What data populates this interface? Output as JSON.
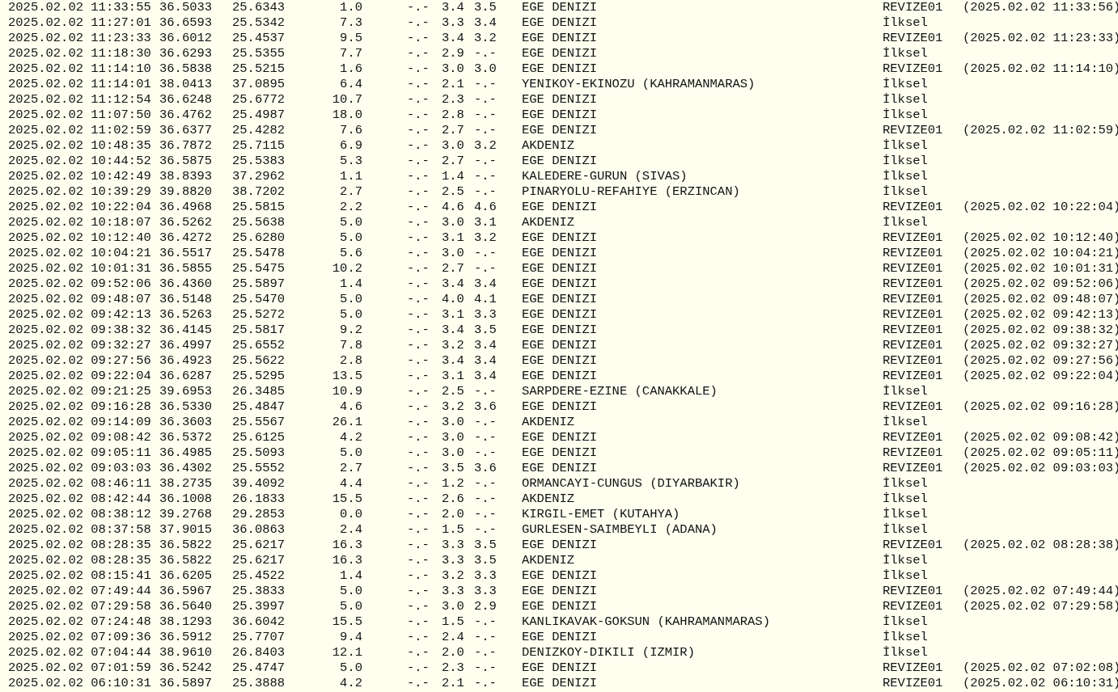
{
  "rows": [
    {
      "date": "2025.02.02 11:33:55",
      "lat": "36.5033",
      "lon": "25.6343",
      "depth": "1.0",
      "md": "-.-",
      "ml": "3.4",
      "mw": "3.5",
      "location": "EGE DENIZI",
      "quality": "REVIZE01",
      "revision": "(2025.02.02 11:33:56)"
    },
    {
      "date": "2025.02.02 11:27:01",
      "lat": "36.6593",
      "lon": "25.5342",
      "depth": "7.3",
      "md": "-.-",
      "ml": "3.3",
      "mw": "3.4",
      "location": "EGE DENIZI",
      "quality": "İlksel"
    },
    {
      "date": "2025.02.02 11:23:33",
      "lat": "36.6012",
      "lon": "25.4537",
      "depth": "9.5",
      "md": "-.-",
      "ml": "3.4",
      "mw": "3.2",
      "location": "EGE DENIZI",
      "quality": "REVIZE01",
      "revision": "(2025.02.02 11:23:33)"
    },
    {
      "date": "2025.02.02 11:18:30",
      "lat": "36.6293",
      "lon": "25.5355",
      "depth": "7.7",
      "md": "-.-",
      "ml": "2.9",
      "mw": "-.-",
      "location": "EGE DENIZI",
      "quality": "İlksel"
    },
    {
      "date": "2025.02.02 11:14:10",
      "lat": "36.5838",
      "lon": "25.5215",
      "depth": "1.6",
      "md": "-.-",
      "ml": "3.0",
      "mw": "3.0",
      "location": "EGE DENIZI",
      "quality": "REVIZE01",
      "revision": "(2025.02.02 11:14:10)"
    },
    {
      "date": "2025.02.02 11:14:01",
      "lat": "38.0413",
      "lon": "37.0895",
      "depth": "6.4",
      "md": "-.-",
      "ml": "2.1",
      "mw": "-.-",
      "location": "YENIKOY-EKINOZU (KAHRAMANMARAS)",
      "quality": "İlksel"
    },
    {
      "date": "2025.02.02 11:12:54",
      "lat": "36.6248",
      "lon": "25.6772",
      "depth": "10.7",
      "md": "-.-",
      "ml": "2.3",
      "mw": "-.-",
      "location": "EGE DENIZI",
      "quality": "İlksel"
    },
    {
      "date": "2025.02.02 11:07:50",
      "lat": "36.4762",
      "lon": "25.4987",
      "depth": "18.0",
      "md": "-.-",
      "ml": "2.8",
      "mw": "-.-",
      "location": "EGE DENIZI",
      "quality": "İlksel"
    },
    {
      "date": "2025.02.02 11:02:59",
      "lat": "36.6377",
      "lon": "25.4282",
      "depth": "7.6",
      "md": "-.-",
      "ml": "2.7",
      "mw": "-.-",
      "location": "EGE DENIZI",
      "quality": "REVIZE01",
      "revision": "(2025.02.02 11:02:59)"
    },
    {
      "date": "2025.02.02 10:48:35",
      "lat": "36.7872",
      "lon": "25.7115",
      "depth": "6.9",
      "md": "-.-",
      "ml": "3.0",
      "mw": "3.2",
      "location": "AKDENIZ",
      "quality": "İlksel"
    },
    {
      "date": "2025.02.02 10:44:52",
      "lat": "36.5875",
      "lon": "25.5383",
      "depth": "5.3",
      "md": "-.-",
      "ml": "2.7",
      "mw": "-.-",
      "location": "EGE DENIZI",
      "quality": "İlksel"
    },
    {
      "date": "2025.02.02 10:42:49",
      "lat": "38.8393",
      "lon": "37.2962",
      "depth": "1.1",
      "md": "-.-",
      "ml": "1.4",
      "mw": "-.-",
      "location": "KALEDERE-GURUN (SIVAS)",
      "quality": "İlksel"
    },
    {
      "date": "2025.02.02 10:39:29",
      "lat": "39.8820",
      "lon": "38.7202",
      "depth": "2.7",
      "md": "-.-",
      "ml": "2.5",
      "mw": "-.-",
      "location": "PINARYOLU-REFAHIYE (ERZINCAN)",
      "quality": "İlksel"
    },
    {
      "date": "2025.02.02 10:22:04",
      "lat": "36.4968",
      "lon": "25.5815",
      "depth": "2.2",
      "md": "-.-",
      "ml": "4.6",
      "mw": "4.6",
      "location": "EGE DENIZI",
      "quality": "REVIZE01",
      "revision": "(2025.02.02 10:22:04)"
    },
    {
      "date": "2025.02.02 10:18:07",
      "lat": "36.5262",
      "lon": "25.5638",
      "depth": "5.0",
      "md": "-.-",
      "ml": "3.0",
      "mw": "3.1",
      "location": "AKDENIZ",
      "quality": "İlksel"
    },
    {
      "date": "2025.02.02 10:12:40",
      "lat": "36.4272",
      "lon": "25.6280",
      "depth": "5.0",
      "md": "-.-",
      "ml": "3.1",
      "mw": "3.2",
      "location": "EGE DENIZI",
      "quality": "REVIZE01",
      "revision": "(2025.02.02 10:12:40)"
    },
    {
      "date": "2025.02.02 10:04:21",
      "lat": "36.5517",
      "lon": "25.5478",
      "depth": "5.6",
      "md": "-.-",
      "ml": "3.0",
      "mw": "-.-",
      "location": "EGE DENIZI",
      "quality": "REVIZE01",
      "revision": "(2025.02.02 10:04:21)"
    },
    {
      "date": "2025.02.02 10:01:31",
      "lat": "36.5855",
      "lon": "25.5475",
      "depth": "10.2",
      "md": "-.-",
      "ml": "2.7",
      "mw": "-.-",
      "location": "EGE DENIZI",
      "quality": "REVIZE01",
      "revision": "(2025.02.02 10:01:31)"
    },
    {
      "date": "2025.02.02 09:52:06",
      "lat": "36.4360",
      "lon": "25.5897",
      "depth": "1.4",
      "md": "-.-",
      "ml": "3.4",
      "mw": "3.4",
      "location": "EGE DENIZI",
      "quality": "REVIZE01",
      "revision": "(2025.02.02 09:52:06)"
    },
    {
      "date": "2025.02.02 09:48:07",
      "lat": "36.5148",
      "lon": "25.5470",
      "depth": "5.0",
      "md": "-.-",
      "ml": "4.0",
      "mw": "4.1",
      "location": "EGE DENIZI",
      "quality": "REVIZE01",
      "revision": "(2025.02.02 09:48:07)"
    },
    {
      "date": "2025.02.02 09:42:13",
      "lat": "36.5263",
      "lon": "25.5272",
      "depth": "5.0",
      "md": "-.-",
      "ml": "3.1",
      "mw": "3.3",
      "location": "EGE DENIZI",
      "quality": "REVIZE01",
      "revision": "(2025.02.02 09:42:13)"
    },
    {
      "date": "2025.02.02 09:38:32",
      "lat": "36.4145",
      "lon": "25.5817",
      "depth": "9.2",
      "md": "-.-",
      "ml": "3.4",
      "mw": "3.5",
      "location": "EGE DENIZI",
      "quality": "REVIZE01",
      "revision": "(2025.02.02 09:38:32)"
    },
    {
      "date": "2025.02.02 09:32:27",
      "lat": "36.4997",
      "lon": "25.6552",
      "depth": "7.8",
      "md": "-.-",
      "ml": "3.2",
      "mw": "3.4",
      "location": "EGE DENIZI",
      "quality": "REVIZE01",
      "revision": "(2025.02.02 09:32:27)"
    },
    {
      "date": "2025.02.02 09:27:56",
      "lat": "36.4923",
      "lon": "25.5622",
      "depth": "2.8",
      "md": "-.-",
      "ml": "3.4",
      "mw": "3.4",
      "location": "EGE DENIZI",
      "quality": "REVIZE01",
      "revision": "(2025.02.02 09:27:56)"
    },
    {
      "date": "2025.02.02 09:22:04",
      "lat": "36.6287",
      "lon": "25.5295",
      "depth": "13.5",
      "md": "-.-",
      "ml": "3.1",
      "mw": "3.4",
      "location": "EGE DENIZI",
      "quality": "REVIZE01",
      "revision": "(2025.02.02 09:22:04)"
    },
    {
      "date": "2025.02.02 09:21:25",
      "lat": "39.6953",
      "lon": "26.3485",
      "depth": "10.9",
      "md": "-.-",
      "ml": "2.5",
      "mw": "-.-",
      "location": "SARPDERE-EZINE (CANAKKALE)",
      "quality": "İlksel"
    },
    {
      "date": "2025.02.02 09:16:28",
      "lat": "36.5330",
      "lon": "25.4847",
      "depth": "4.6",
      "md": "-.-",
      "ml": "3.2",
      "mw": "3.6",
      "location": "EGE DENIZI",
      "quality": "REVIZE01",
      "revision": "(2025.02.02 09:16:28)"
    },
    {
      "date": "2025.02.02 09:14:09",
      "lat": "36.3603",
      "lon": "25.5567",
      "depth": "26.1",
      "md": "-.-",
      "ml": "3.0",
      "mw": "-.-",
      "location": "AKDENIZ",
      "quality": "İlksel"
    },
    {
      "date": "2025.02.02 09:08:42",
      "lat": "36.5372",
      "lon": "25.6125",
      "depth": "4.2",
      "md": "-.-",
      "ml": "3.0",
      "mw": "-.-",
      "location": "EGE DENIZI",
      "quality": "REVIZE01",
      "revision": "(2025.02.02 09:08:42)"
    },
    {
      "date": "2025.02.02 09:05:11",
      "lat": "36.4985",
      "lon": "25.5093",
      "depth": "5.0",
      "md": "-.-",
      "ml": "3.0",
      "mw": "-.-",
      "location": "EGE DENIZI",
      "quality": "REVIZE01",
      "revision": "(2025.02.02 09:05:11)"
    },
    {
      "date": "2025.02.02 09:03:03",
      "lat": "36.4302",
      "lon": "25.5552",
      "depth": "2.7",
      "md": "-.-",
      "ml": "3.5",
      "mw": "3.6",
      "location": "EGE DENIZI",
      "quality": "REVIZE01",
      "revision": "(2025.02.02 09:03:03)"
    },
    {
      "date": "2025.02.02 08:46:11",
      "lat": "38.2735",
      "lon": "39.4092",
      "depth": "4.4",
      "md": "-.-",
      "ml": "1.2",
      "mw": "-.-",
      "location": "ORMANCAYI-CUNGUS (DIYARBAKIR)",
      "quality": "İlksel"
    },
    {
      "date": "2025.02.02 08:42:44",
      "lat": "36.1008",
      "lon": "26.1833",
      "depth": "15.5",
      "md": "-.-",
      "ml": "2.6",
      "mw": "-.-",
      "location": "AKDENIZ",
      "quality": "İlksel"
    },
    {
      "date": "2025.02.02 08:38:12",
      "lat": "39.2768",
      "lon": "29.2853",
      "depth": "0.0",
      "md": "-.-",
      "ml": "2.0",
      "mw": "-.-",
      "location": "KIRGIL-EMET (KUTAHYA)",
      "quality": "İlksel"
    },
    {
      "date": "2025.02.02 08:37:58",
      "lat": "37.9015",
      "lon": "36.0863",
      "depth": "2.4",
      "md": "-.-",
      "ml": "1.5",
      "mw": "-.-",
      "location": "GURLESEN-SAIMBEYLI (ADANA)",
      "quality": "İlksel"
    },
    {
      "date": "2025.02.02 08:28:35",
      "lat": "36.5822",
      "lon": "25.6217",
      "depth": "16.3",
      "md": "-.-",
      "ml": "3.3",
      "mw": "3.5",
      "location": "EGE DENIZI",
      "quality": "REVIZE01",
      "revision": "(2025.02.02 08:28:38)"
    },
    {
      "date": "2025.02.02 08:28:35",
      "lat": "36.5822",
      "lon": "25.6217",
      "depth": "16.3",
      "md": "-.-",
      "ml": "3.3",
      "mw": "3.5",
      "location": "AKDENIZ",
      "quality": "İlksel"
    },
    {
      "date": "2025.02.02 08:15:41",
      "lat": "36.6205",
      "lon": "25.4522",
      "depth": "1.4",
      "md": "-.-",
      "ml": "3.2",
      "mw": "3.3",
      "location": "EGE DENIZI",
      "quality": "İlksel"
    },
    {
      "date": "2025.02.02 07:49:44",
      "lat": "36.5967",
      "lon": "25.3833",
      "depth": "5.0",
      "md": "-.-",
      "ml": "3.3",
      "mw": "3.3",
      "location": "EGE DENIZI",
      "quality": "REVIZE01",
      "revision": "(2025.02.02 07:49:44)"
    },
    {
      "date": "2025.02.02 07:29:58",
      "lat": "36.5640",
      "lon": "25.3997",
      "depth": "5.0",
      "md": "-.-",
      "ml": "3.0",
      "mw": "2.9",
      "location": "EGE DENIZI",
      "quality": "REVIZE01",
      "revision": "(2025.02.02 07:29:58)"
    },
    {
      "date": "2025.02.02 07:24:48",
      "lat": "38.1293",
      "lon": "36.6042",
      "depth": "15.5",
      "md": "-.-",
      "ml": "1.5",
      "mw": "-.-",
      "location": "KANLIKAVAK-GOKSUN (KAHRAMANMARAS)",
      "quality": "İlksel"
    },
    {
      "date": "2025.02.02 07:09:36",
      "lat": "36.5912",
      "lon": "25.7707",
      "depth": "9.4",
      "md": "-.-",
      "ml": "2.4",
      "mw": "-.-",
      "location": "EGE DENIZI",
      "quality": "İlksel"
    },
    {
      "date": "2025.02.02 07:04:44",
      "lat": "38.9610",
      "lon": "26.8403",
      "depth": "12.1",
      "md": "-.-",
      "ml": "2.0",
      "mw": "-.-",
      "location": "DENIZKOY-DIKILI (IZMIR)",
      "quality": "İlksel"
    },
    {
      "date": "2025.02.02 07:01:59",
      "lat": "36.5242",
      "lon": "25.4747",
      "depth": "5.0",
      "md": "-.-",
      "ml": "2.3",
      "mw": "-.-",
      "location": "EGE DENIZI",
      "quality": "REVIZE01",
      "revision": "(2025.02.02 07:02:08)"
    },
    {
      "date": "2025.02.02 06:10:31",
      "lat": "36.5897",
      "lon": "25.3888",
      "depth": "4.2",
      "md": "-.-",
      "ml": "2.1",
      "mw": "-.-",
      "location": "EGE DENIZI",
      "quality": "REVIZE01",
      "revision": "(2025.02.02 06:10:31)"
    }
  ]
}
